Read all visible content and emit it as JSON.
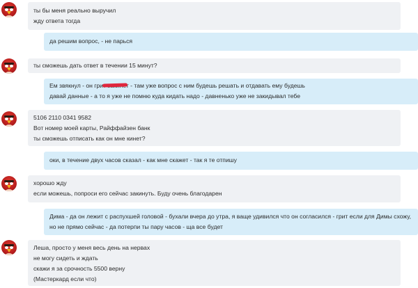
{
  "messages": [
    {
      "dir": "in",
      "lines": [
        "ты бы меня реально выручил",
        "жду ответа тогда"
      ]
    },
    {
      "dir": "out",
      "lines": [
        "да решим вопрос, - не парься"
      ]
    },
    {
      "dir": "in",
      "lines": [
        "ты сможешь дать ответ в течении 15 минут?"
      ]
    },
    {
      "dir": "out",
      "lines": [
        "Ем                звякнул - он грит закинет - там уже вопрос с ним будешь решать и отдавать ему будешь",
        "давай данные - а то я уже не помню куда кидать надо - давненько уже не закидывал тебе"
      ]
    },
    {
      "dir": "in",
      "lines": [
        "5106 2110 0341 9582",
        "Вот номер моей карты, Райффайзен банк",
        "ты сможешь отписать как он мне кинет?"
      ]
    },
    {
      "dir": "out",
      "lines": [
        "оки, в течение двух часов сказал - как мне скажет - так я те отпишу"
      ]
    },
    {
      "dir": "in",
      "lines": [
        "хорошо жду",
        "если можешь, попроси его сейчас закинуть. Буду очень благодарен"
      ]
    },
    {
      "dir": "out",
      "lines": [
        "Дима - да он лежит с распухшей головой - бухали вчера до утра, я ваще удивился что он согласился - грит если для Димы схожу,",
        "но не прямо сейчас - да потерпи ты пару часов - ща все будет"
      ]
    },
    {
      "dir": "in",
      "lines": [
        "Леша, просто у меня весь день на нервах",
        "не могу сидеть и ждать",
        "скажи я за срочность 5500 верну",
        "(Мастеркард если что)"
      ]
    }
  ]
}
